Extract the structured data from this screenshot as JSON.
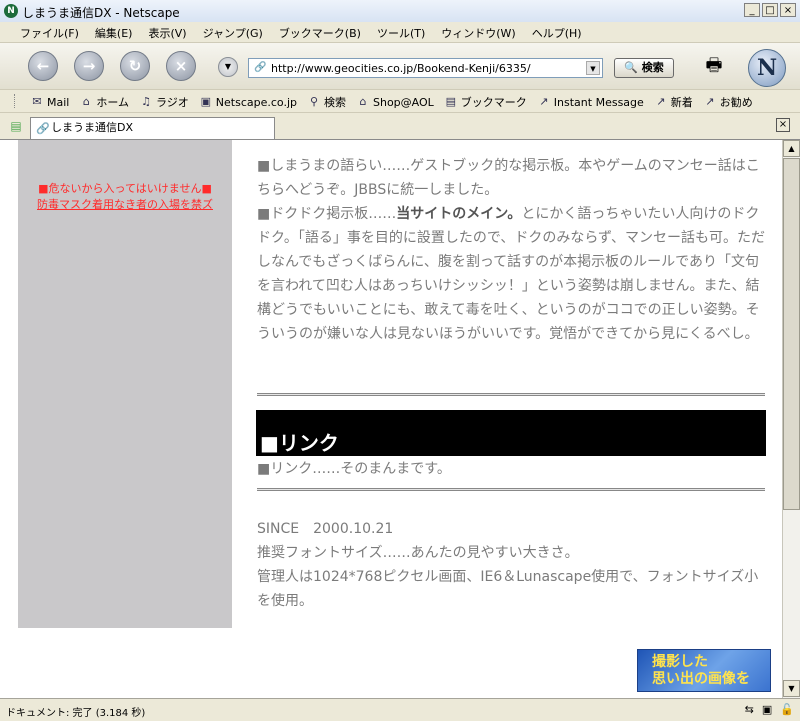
{
  "window": {
    "title": "しまうま通信DX - Netscape",
    "app_icon_letter": "N"
  },
  "menu": [
    "ファイル(F)",
    "編集(E)",
    "表示(V)",
    "ジャンプ(G)",
    "ブックマーク(B)",
    "ツール(T)",
    "ウィンドウ(W)",
    "ヘルプ(H)"
  ],
  "navbar": {
    "url": "http://www.geocities.co.jp/Bookend-Kenji/6335/",
    "search_label": "検索"
  },
  "personal_bar": [
    {
      "label": "Mail",
      "icon": "mail-icon"
    },
    {
      "label": "ホーム",
      "icon": "home-icon"
    },
    {
      "label": "ラジオ",
      "icon": "radio-icon"
    },
    {
      "label": "Netscape.co.jp",
      "icon": "netscape-icon"
    },
    {
      "label": "検索",
      "icon": "search-icon"
    },
    {
      "label": "Shop@AOL",
      "icon": "shop-icon"
    },
    {
      "label": "ブックマーク",
      "icon": "bookmark-icon"
    },
    {
      "label": "Instant Message",
      "icon": "im-icon"
    },
    {
      "label": "新着",
      "icon": "new-icon"
    },
    {
      "label": "お勧め",
      "icon": "recommend-icon"
    }
  ],
  "tab": {
    "title": "しまうま通信DX"
  },
  "sidebar": {
    "warning_line1": "■危ないから入ってはいけません■",
    "warning_line2": "防毒マスク着用なき者の入場を禁ズ"
  },
  "main": {
    "para1": "■しまうまの語らい……ゲストブック的な掲示板。本やゲームのマンセー話はこちらへどうぞ。JBBSに統一しました。",
    "para2_prefix": "■ドクドク掲示板……",
    "para2_bold": "当サイトのメイン。",
    "para2_rest": "とにかく語っちゃいたい人向けのドクドク。「語る」事を目的に設置したので、ドクのみならず、マンセー話も可。ただしなんでもざっくばらんに、腹を割って話すのが本掲示板のルールであり「文句を言われて凹む人はあっちいけシッシッ！」という姿勢は崩しません。また、結構どうでもいいことにも、敢えて毒を吐く、というのがココでの正しい姿勢。そういうのが嫌いな人は見ないほうがいいです。覚悟ができてから見にくるべし。",
    "link_heading": "■リンク",
    "link_text": "■リンク……そのまんまです。",
    "since": "SINCE　2000.10.21",
    "font_note": "推奨フォントサイズ……あんたの見やすい大きさ。",
    "admin_note": "管理人は1024*768ピクセル画面、IE6＆Lunascape使用で、フォントサイズ小を使用。"
  },
  "banner": {
    "line1": "撮影した",
    "line2": "思い出の画像を"
  },
  "status": {
    "text": "ドキュメント: 完了 (3.184 秒)"
  }
}
